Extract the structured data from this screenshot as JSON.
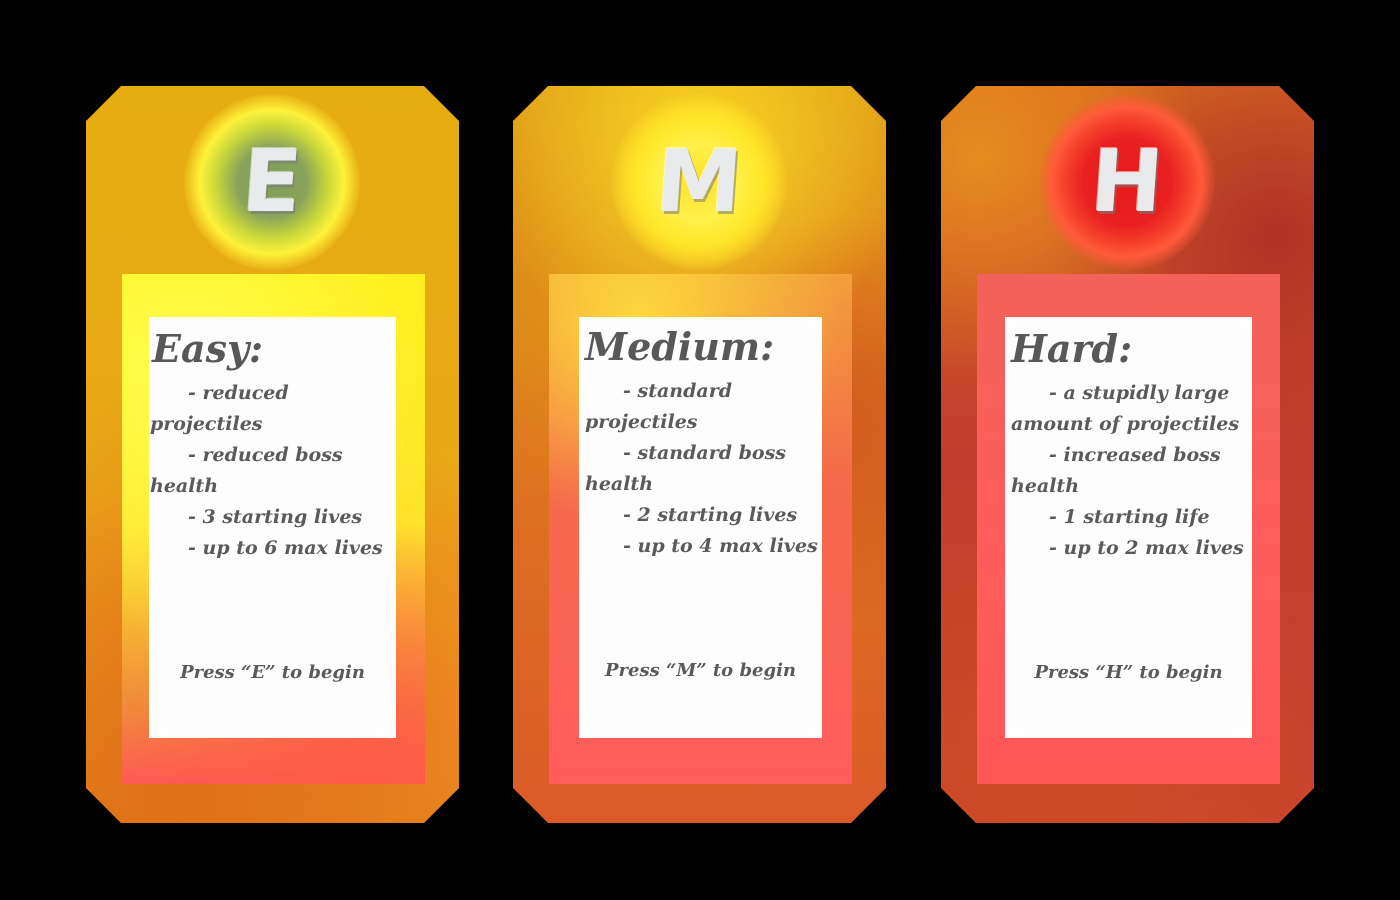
{
  "cards": [
    {
      "key": "easy",
      "letter": "E",
      "title": "Easy:",
      "bullets": [
        "- reduced projectiles",
        "- reduced boss health",
        "- 3 starting lives",
        "- up to 6 max lives"
      ],
      "prompt": "Press “E” to begin",
      "badge_color": "#8aa35a",
      "accent_color": "#e6ad10"
    },
    {
      "key": "medium",
      "letter": "M",
      "title": "Medium:",
      "bullets": [
        "- standard projectiles",
        "- standard boss health",
        "- 2 starting lives",
        "- up to 4 max lives"
      ],
      "prompt": "Press “M” to begin",
      "badge_color": "#ffe02a",
      "accent_color": "#df7520"
    },
    {
      "key": "hard",
      "letter": "H",
      "title": "Hard:",
      "bullets": [
        "- a stupidly large amount of projectiles",
        "- increased boss health",
        "- 1 starting life",
        "- up to 2 max lives"
      ],
      "prompt": "Press “H” to begin",
      "badge_color": "#e81b1b",
      "accent_color": "#c23c2e"
    }
  ]
}
